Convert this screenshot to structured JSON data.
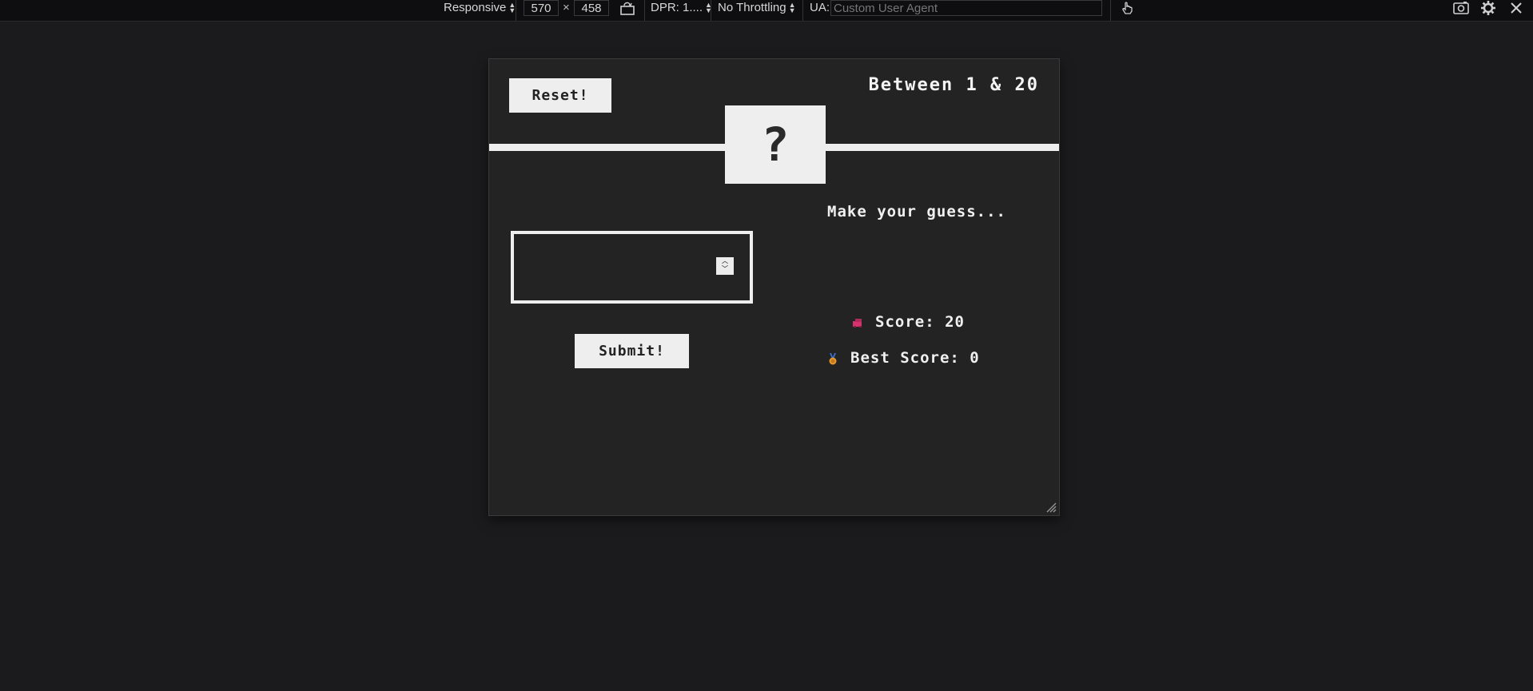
{
  "devtools": {
    "device": "Responsive",
    "width": "570",
    "times": "×",
    "height": "458",
    "dpr": "DPR: 1....",
    "throttling": "No Throttling",
    "ua_label": "UA:",
    "ua_placeholder": "Custom User Agent"
  },
  "game": {
    "reset_label": "Reset!",
    "range_title": "Between 1 & 20",
    "secret": "?",
    "message": "Make your guess...",
    "guess_value": "",
    "submit_label": "Submit!",
    "score_label": "Score: 20",
    "best_score_label": "Best Score: 0"
  },
  "colors": {
    "page_bg": "#1b1b1d",
    "game_bg": "#232323",
    "accent": "#eeeeee",
    "score_icon": "#d6336c",
    "medal": "#e59a2e"
  },
  "icons": {
    "rotate": "rotate-viewport-icon",
    "touch": "touch-icon",
    "screenshot": "camera-icon",
    "settings": "gear-icon",
    "close": "close-icon",
    "score": "score-icon",
    "best": "medal-icon"
  }
}
